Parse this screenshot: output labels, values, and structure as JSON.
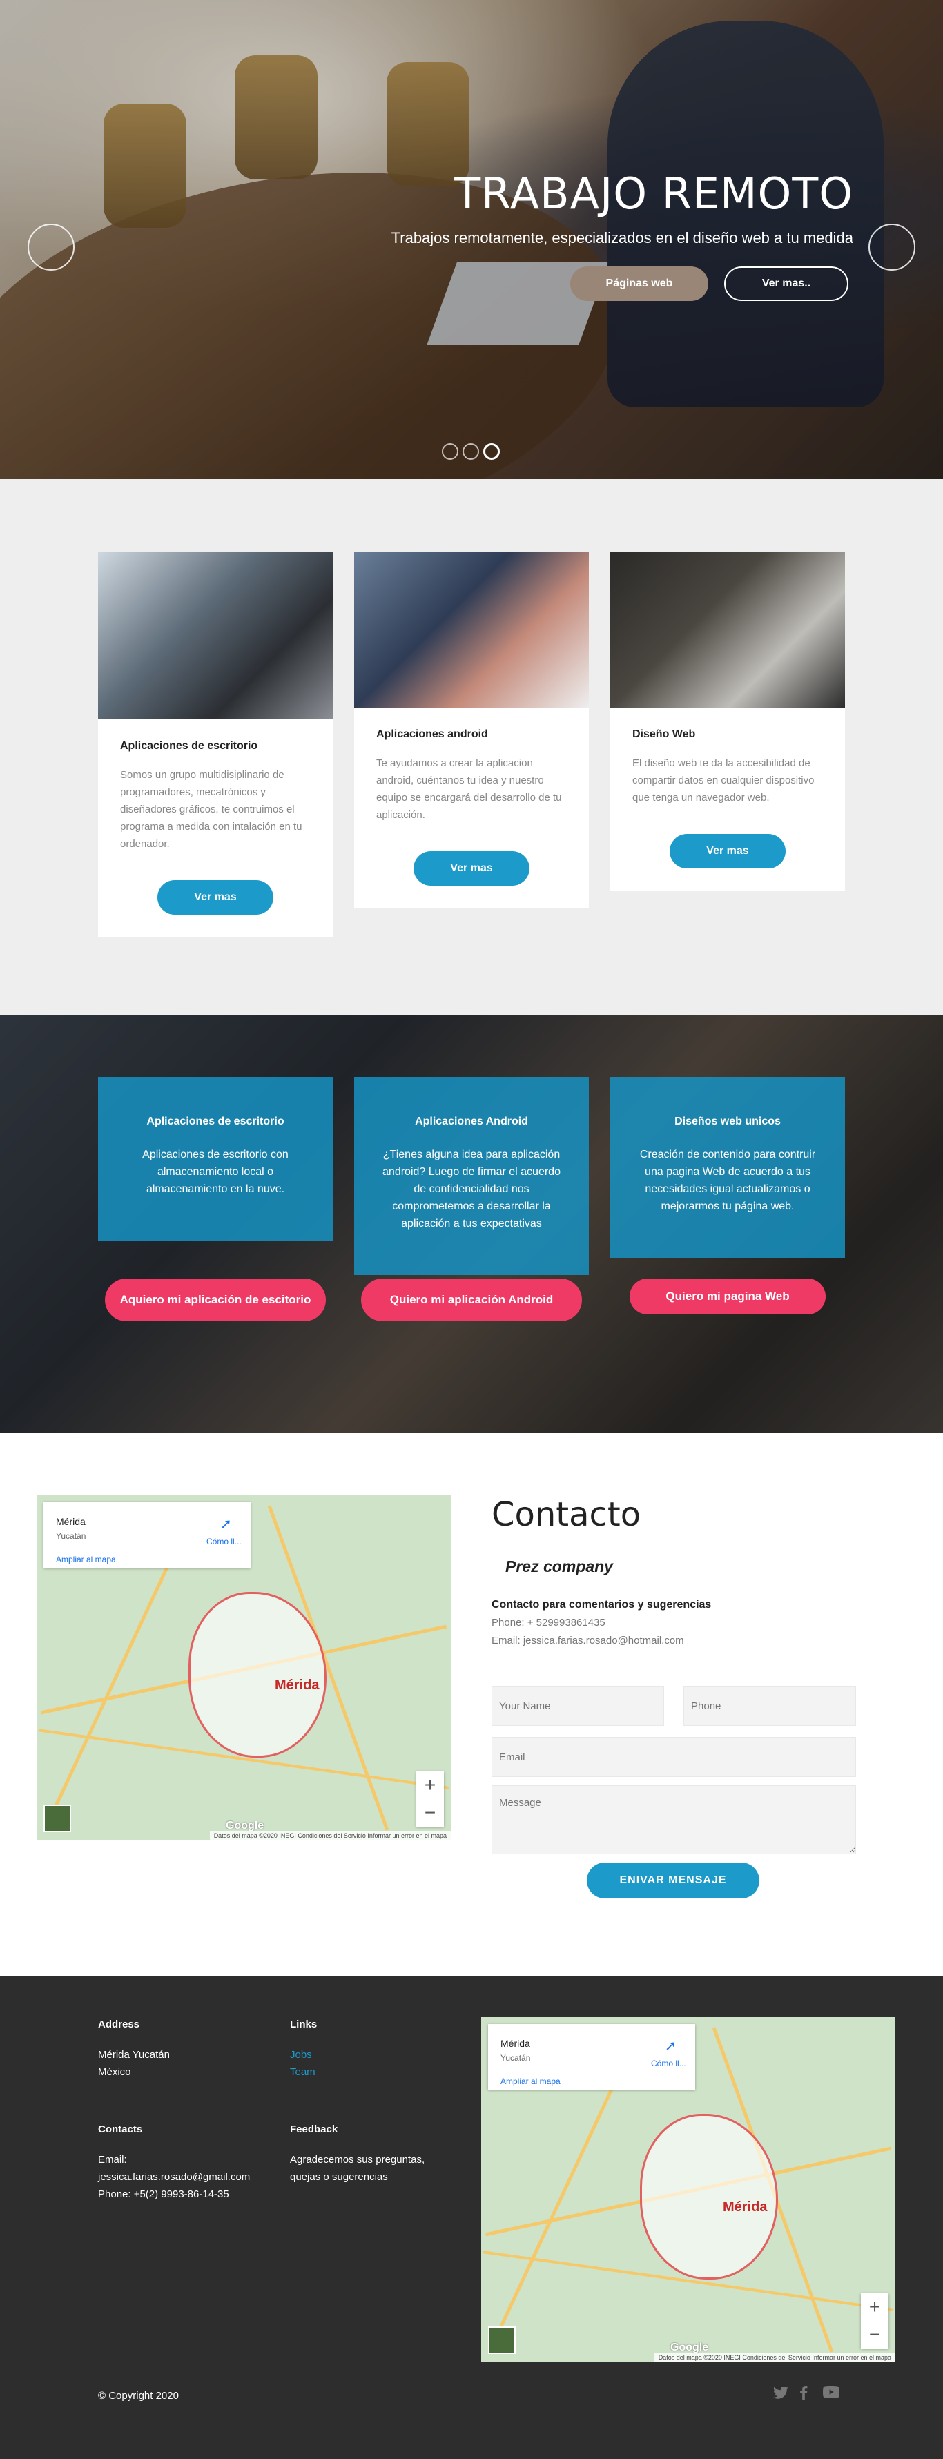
{
  "hero": {
    "title": "TRABAJO REMOTO",
    "subtitle": "Trabajos remotamente, especializados en el diseño web a tu medida",
    "btn_primary": "Páginas web",
    "btn_outline": "Ver mas.."
  },
  "cards": [
    {
      "title": "Aplicaciones de escritorio",
      "text": "Somos un grupo multidisiplinario de programadores, mecatrónicos y diseñadores gráficos, te contruimos el programa a medida con intalación en tu ordenador.",
      "button": "Ver mas"
    },
    {
      "title": "Aplicaciones android",
      "text": "Te ayudamos a crear la aplicacion android, cuéntanos tu idea y nuestro equipo se encargará del desarrollo de tu aplicación.",
      "button": "Ver mas"
    },
    {
      "title": "Diseño Web",
      "text": "El diseño web te da la accesibilidad de compartir datos en cualquier dispositivo que tenga un navegador web.",
      "button": "Ver mas"
    }
  ],
  "offers": [
    {
      "title": "Aplicaciones de escritorio",
      "text": "Aplicaciones de escritorio con almacenamiento local o almacenamiento en la nuve.",
      "button": "Aquiero mi aplicación de escitorio"
    },
    {
      "title": "Aplicaciones Android",
      "text": "¿Tienes alguna idea para aplicación android? Luego de firmar el acuerdo de confidencialidad nos comprometemos a desarrollar la aplicación a tus expectativas",
      "button": "Quiero mi aplicación Android"
    },
    {
      "title": "Diseños web unicos",
      "text": "Creación de contenido para contruir una pagina Web de acuerdo a tus necesidades igual actualizamos o mejorarmos tu página web.",
      "button": "Quiero mi pagina Web"
    }
  ],
  "map": {
    "place": "Mérida",
    "region": "Yucatán",
    "directions": "Cómo ll...",
    "enlarge": "Ampliar al mapa",
    "city_label": "Mérida",
    "google": "Google",
    "footer": "Datos del mapa ©2020 INEGI   Condiciones del Servicio   Informar un error en el mapa"
  },
  "contact": {
    "heading": "Contacto",
    "company": "Prez company",
    "title": "Contacto para comentarios y sugerencias",
    "phone": "Phone: + 529993861435",
    "email": "Email: jessica.farias.rosado@hotmail.com",
    "name_placeholder": "Your Name",
    "phone_placeholder": "Phone",
    "email_placeholder": "Email",
    "message_placeholder": "Message",
    "send": "ENIVAR MENSAJE"
  },
  "footer": {
    "address_title": "Address",
    "address_line1": "Mérida Yucatán",
    "address_line2": "México",
    "links_title": "Links",
    "link_jobs": "Jobs",
    "link_team": "Team",
    "contacts_title": "Contacts",
    "contact_email_label": "Email:",
    "contact_email": "jessica.farias.rosado@gmail.com",
    "contact_phone": "Phone: +5(2) 9993-86-14-35",
    "feedback_title": "Feedback",
    "feedback_line1": "Agradecemos sus preguntas,",
    "feedback_line2": "quejas o sugerencias",
    "copyright": "© Copyright 2020"
  },
  "icons": {
    "twitter": "twitter-icon",
    "facebook": "facebook-icon",
    "youtube": "youtube-icon"
  },
  "colors": {
    "accent_blue": "#1c9ac9",
    "accent_pink": "#f03a66",
    "footer_bg": "#2d2d2d"
  }
}
